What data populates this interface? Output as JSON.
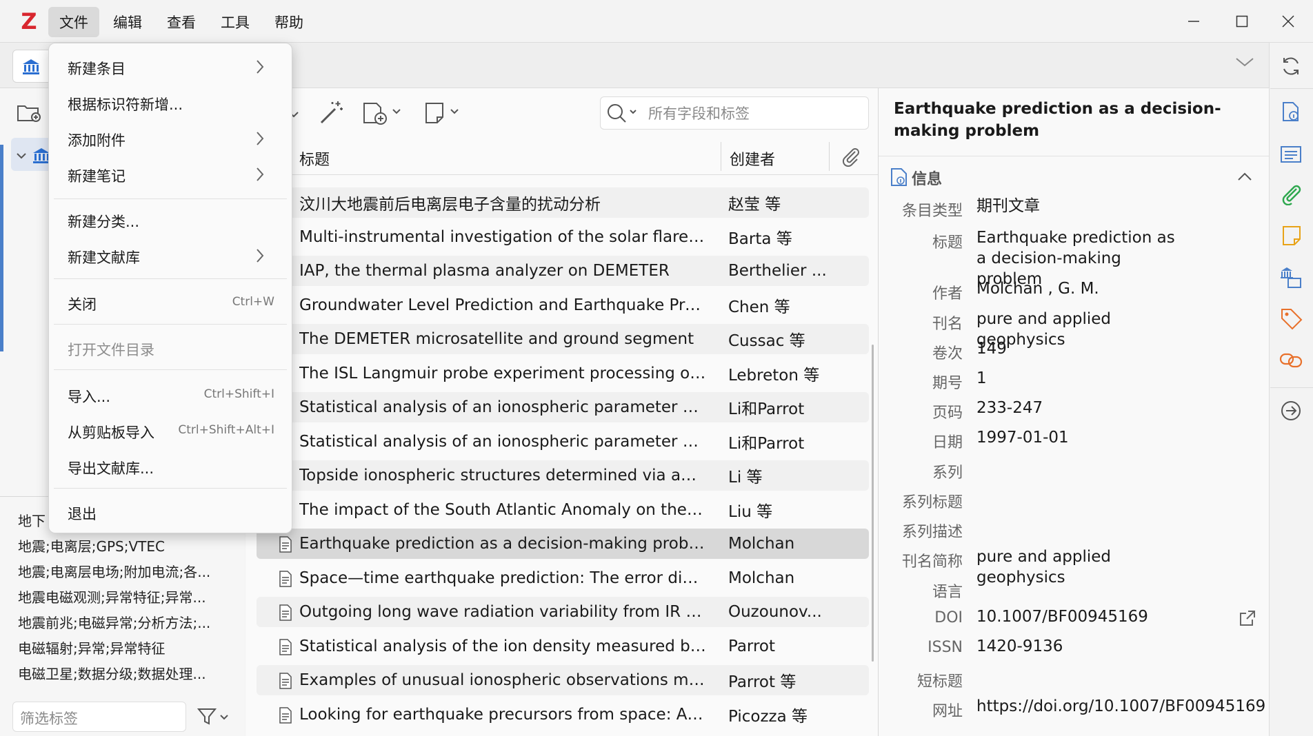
{
  "menubar": {
    "logo": "Z",
    "items": [
      "文件",
      "编辑",
      "查看",
      "工具",
      "帮助"
    ]
  },
  "file_menu": {
    "items": [
      {
        "label": "新建条目",
        "submenu": true
      },
      {
        "label": "根据标识符新增..."
      },
      {
        "label": "添加附件",
        "submenu": true
      },
      {
        "label": "新建笔记",
        "submenu": true
      },
      {
        "label": "新建分类..."
      },
      {
        "label": "新建文献库",
        "submenu": true
      },
      {
        "label": "关闭",
        "shortcut": "Ctrl+W"
      },
      {
        "label": "打开文件目录",
        "disabled": true
      },
      {
        "label": "导入...",
        "shortcut": "Ctrl+Shift+I"
      },
      {
        "label": "从剪贴板导入",
        "shortcut": "Ctrl+Shift+Alt+I"
      },
      {
        "label": "导出文献库..."
      },
      {
        "label": "退出"
      }
    ]
  },
  "tags": {
    "items": [
      "地下",
      "地震;电离层;GPS;VTEC",
      "地震;电离层电场;附加电流;各...",
      "地震电磁观测;异常特征;异常...",
      "地震前兆;电磁异常;分析方法;...",
      "电磁辐射;异常;异常特征",
      "电磁卫星;数据分级;数据处理..."
    ],
    "filter_placeholder": "筛选标签"
  },
  "items_pane": {
    "search_placeholder": "所有字段和标签",
    "columns": {
      "title": "标题",
      "creator": "创建者"
    },
    "rows": [
      {
        "title": "汶川大地震前后电离层电子含量的扰动分析",
        "creator": "赵莹 等"
      },
      {
        "title": "Multi-instrumental investigation of the solar flares i...",
        "creator": "Barta 等"
      },
      {
        "title": "IAP, the thermal plasma analyzer on DEMETER",
        "creator": "Berthelier ..."
      },
      {
        "title": "Groundwater Level Prediction and Earthquake Precu...",
        "creator": "Chen 等"
      },
      {
        "title": "The DEMETER microsatellite and ground segment",
        "creator": "Cussac 等"
      },
      {
        "title": "The ISL Langmuir probe experiment processing onb...",
        "creator": "Lebreton 等"
      },
      {
        "title": "Statistical analysis of an ionospheric parameter as a ...",
        "creator": "Li和Parrot"
      },
      {
        "title": "Statistical analysis of an ionospheric parameter as a ...",
        "creator": "Li和Parrot"
      },
      {
        "title": "Topside ionospheric structures determined via auto...",
        "creator": "Li 等"
      },
      {
        "title": "The impact of the South Atlantic Anomaly on the au...",
        "creator": "Liu 等"
      },
      {
        "title": "Earthquake prediction as a decision-making problem",
        "creator": "Molchan"
      },
      {
        "title": "Space—time earthquake prediction: The error diagr...",
        "creator": "Molchan"
      },
      {
        "title": "Outgoing long wave radiation variability from IR sat...",
        "creator": "Ouzounov..."
      },
      {
        "title": "Statistical analysis of the ion density measured by th...",
        "creator": "Parrot"
      },
      {
        "title": "Examples of unusual ionospheric observations mad...",
        "creator": "Parrot 等"
      },
      {
        "title": "Looking for earthquake precursors from space: A cri...",
        "creator": "Picozza 等"
      }
    ]
  },
  "item_pane": {
    "header_title": "Earthquake prediction as a decision-making problem",
    "section": "信息",
    "fields": [
      {
        "label": "条目类型",
        "value": "期刊文章"
      },
      {
        "label": "标题",
        "value": "Earthquake prediction as a decision-making problem"
      },
      {
        "label": "作者",
        "value": "Molchan , G. M."
      },
      {
        "label": "刊名",
        "value": "pure and applied geophysics"
      },
      {
        "label": "卷次",
        "value": "149"
      },
      {
        "label": "期号",
        "value": "1"
      },
      {
        "label": "页码",
        "value": "233-247"
      },
      {
        "label": "日期",
        "value": "1997-01-01"
      },
      {
        "label": "系列",
        "value": ""
      },
      {
        "label": "系列标题",
        "value": ""
      },
      {
        "label": "系列描述",
        "value": ""
      },
      {
        "label": "刊名简称",
        "value": "pure and applied geophysics"
      },
      {
        "label": "语言",
        "value": ""
      },
      {
        "label": "DOI",
        "value": "10.1007/BF00945169"
      },
      {
        "label": "ISSN",
        "value": "1420-9136"
      },
      {
        "label": "短标题",
        "value": ""
      },
      {
        "label": "网址",
        "value": "https://doi.org/10.1007/BF00945169"
      }
    ]
  }
}
